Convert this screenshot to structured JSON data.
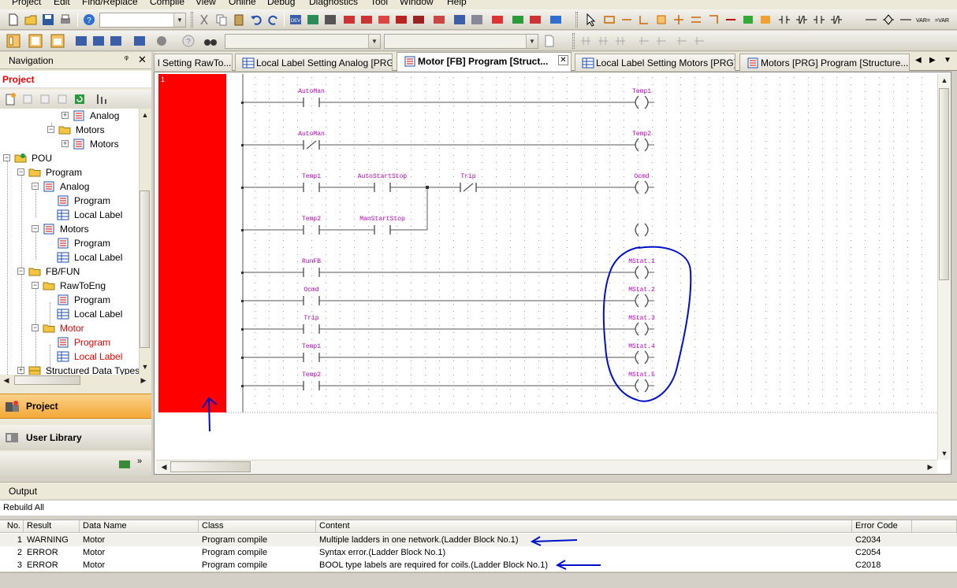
{
  "menu": [
    "Project",
    "Edit",
    "Find/Replace",
    "Compile",
    "View",
    "Online",
    "Debug",
    "Diagnostics",
    "Tool",
    "Window",
    "Help"
  ],
  "navigation": {
    "title": "Navigation",
    "pin": "ᵠ",
    "close": "✕",
    "project_label": "Project",
    "tree": [
      {
        "label": "Analog",
        "icon": "program-icon"
      },
      {
        "label": "Motors",
        "icon": "folder-icon"
      },
      {
        "label": "Motors",
        "icon": "program-icon"
      },
      {
        "label": "POU",
        "icon": "pou-icon"
      },
      {
        "label": "Program",
        "icon": "folder-icon"
      },
      {
        "label": "Analog",
        "icon": "program-icon"
      },
      {
        "label": "Program",
        "icon": "program-icon"
      },
      {
        "label": "Local Label",
        "icon": "label-icon"
      },
      {
        "label": "Motors",
        "icon": "program-icon"
      },
      {
        "label": "Program",
        "icon": "program-icon"
      },
      {
        "label": "Local Label",
        "icon": "label-icon"
      },
      {
        "label": "FB/FUN",
        "icon": "folder-icon"
      },
      {
        "label": "RawToEng",
        "icon": "folder-icon"
      },
      {
        "label": "Program",
        "icon": "program-icon"
      },
      {
        "label": "Local Label",
        "icon": "label-icon"
      },
      {
        "label": "Motor",
        "icon": "folder-icon"
      },
      {
        "label": "Program",
        "icon": "program-icon"
      },
      {
        "label": "Local Label",
        "icon": "label-icon"
      },
      {
        "label": "Structured Data Types",
        "icon": "struct-icon"
      }
    ],
    "bottom_project": "Project",
    "bottom_library": "User Library"
  },
  "tabs": [
    {
      "label": "l Setting RawTo...",
      "active": false
    },
    {
      "label": "Local Label Setting Analog [PRG]",
      "active": false
    },
    {
      "label": "Motor [FB] Program [Struct...",
      "active": true
    },
    {
      "label": "Local Label Setting Motors [PRG]",
      "active": false
    },
    {
      "label": "Motors [PRG] Program [Structure...",
      "active": false
    }
  ],
  "editor": {
    "block_number": "1",
    "rungs": [
      {
        "contacts": [
          {
            "label": "AutoMan",
            "type": "NO"
          }
        ],
        "coil": "Temp1"
      },
      {
        "contacts": [
          {
            "label": "AutoMan",
            "type": "NC"
          }
        ],
        "coil": "Temp2"
      },
      {
        "contacts": [
          {
            "label": "Temp1",
            "type": "NO"
          },
          {
            "label": "AutoStartStop",
            "type": "NO"
          },
          {
            "label": "Trip",
            "type": "NC"
          }
        ],
        "coil": "Ocmd"
      },
      {
        "contacts": [
          {
            "label": "Temp2",
            "type": "NO"
          },
          {
            "label": "ManStartStop",
            "type": "NO"
          }
        ],
        "coil": ""
      },
      {
        "contacts": [
          {
            "label": "RunFB",
            "type": "NO"
          }
        ],
        "coil": "MStat.1"
      },
      {
        "contacts": [
          {
            "label": "Ocmd",
            "type": "NO"
          }
        ],
        "coil": "MStat.2"
      },
      {
        "contacts": [
          {
            "label": "Trip",
            "type": "NO"
          }
        ],
        "coil": "MStat.3"
      },
      {
        "contacts": [
          {
            "label": "Temp1",
            "type": "NO"
          }
        ],
        "coil": "MStat.4"
      },
      {
        "contacts": [
          {
            "label": "Temp2",
            "type": "NO"
          }
        ],
        "coil": "MStat.5"
      }
    ]
  },
  "output": {
    "title": "Output",
    "subtitle": "Rebuild All",
    "columns": [
      "No.",
      "Result",
      "Data Name",
      "Class",
      "Content",
      "Error Code"
    ],
    "rows": [
      {
        "no": "1",
        "result": "WARNING",
        "data_name": "Motor",
        "class": "Program compile",
        "content": "Multiple ladders in one network.(Ladder Block No.1)",
        "code": "C2034"
      },
      {
        "no": "2",
        "result": "ERROR",
        "data_name": "Motor",
        "class": "Program compile",
        "content": "Syntax error.(Ladder Block No.1)",
        "code": "C2054"
      },
      {
        "no": "3",
        "result": "ERROR",
        "data_name": "Motor",
        "class": "Program compile",
        "content": "BOOL type labels are required for coils.(Ladder Block No.1)",
        "code": "C2018"
      }
    ]
  },
  "colors": {
    "accent_red": "#ff0000",
    "ladder_label": "#c000c0",
    "annotation": "#0010c8",
    "nav_active": "#f3a837"
  }
}
